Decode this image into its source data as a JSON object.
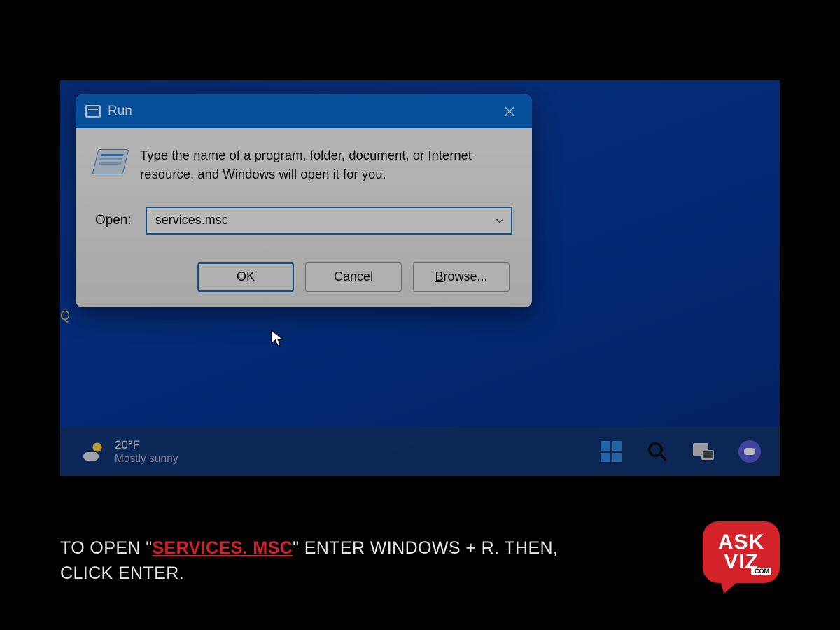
{
  "desktop": {
    "cut_label": "Q"
  },
  "run_dialog": {
    "title": "Run",
    "description": "Type the name of a program, folder, document, or Internet resource, and Windows will open it for you.",
    "open_label_prefix": "O",
    "open_label_rest": "pen:",
    "input_value": "services.msc",
    "buttons": {
      "ok": "OK",
      "cancel": "Cancel",
      "browse_prefix": "B",
      "browse_rest": "rowse..."
    }
  },
  "taskbar": {
    "temperature": "20°F",
    "condition": "Mostly sunny"
  },
  "caption": {
    "pre": "TO OPEN \"",
    "highlight": "SERVICES. MSC",
    "post": "\" ENTER WINDOWS + R. THEN, CLICK ENTER."
  },
  "brand": {
    "line1": "ASK",
    "line2": "VIZ",
    "sub": ".COM"
  }
}
